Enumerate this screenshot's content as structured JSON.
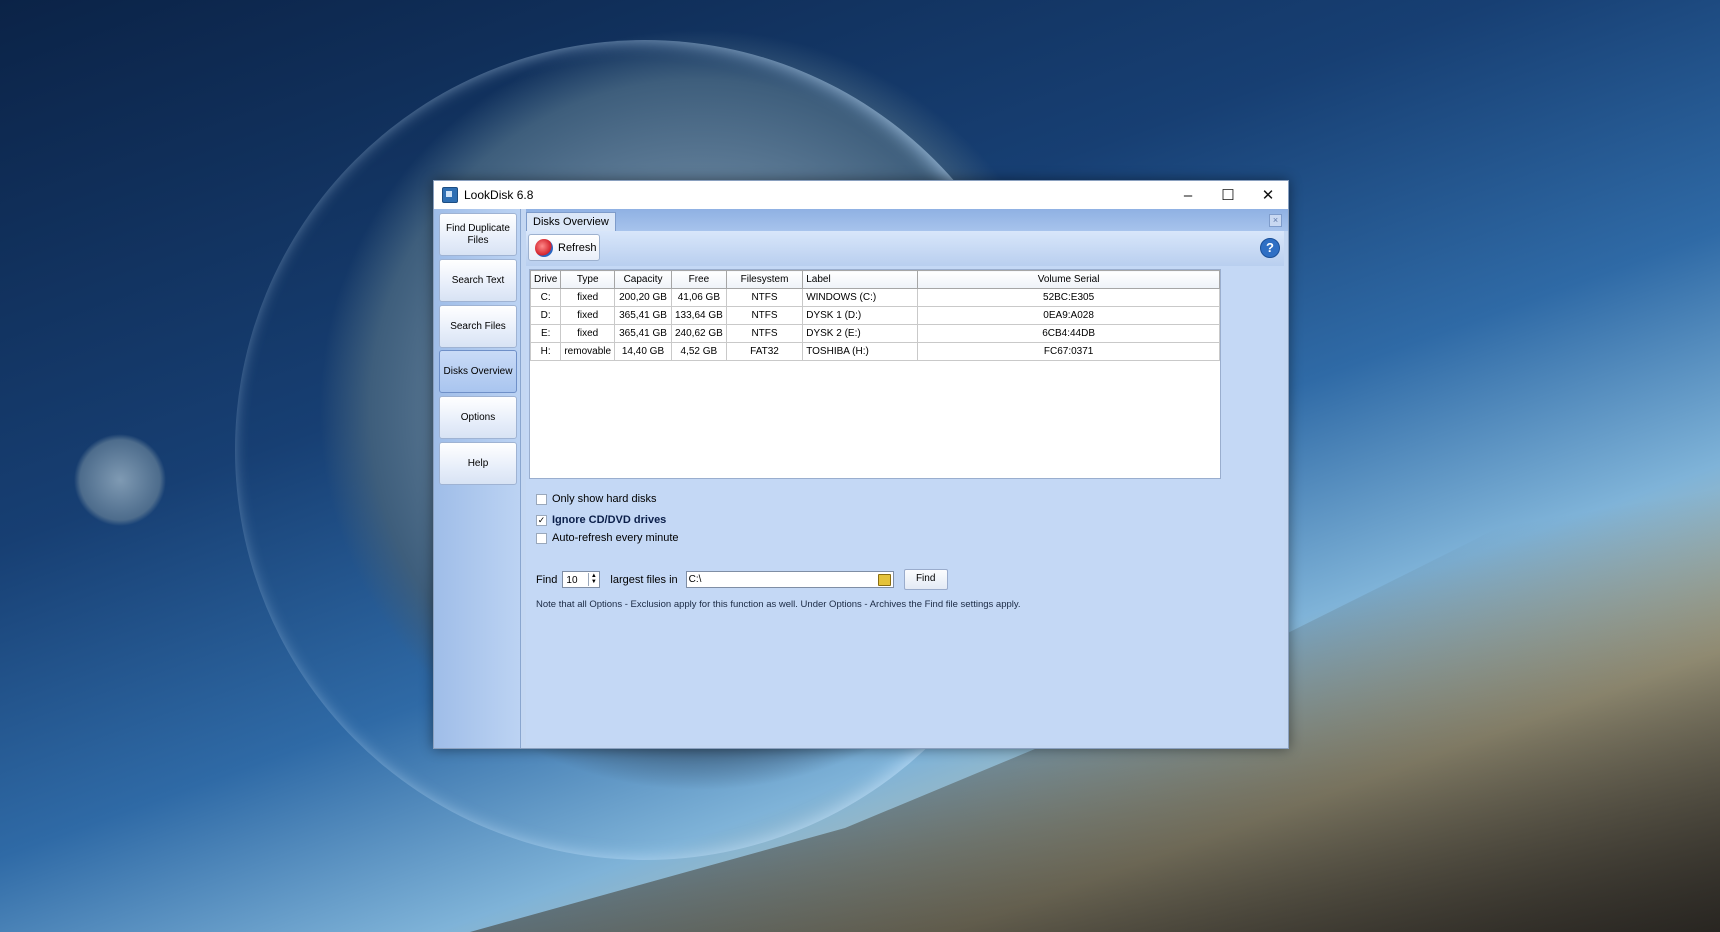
{
  "window": {
    "title": "LookDisk 6.8",
    "icons": {
      "app": "app-icon",
      "minimize": "minimize-icon",
      "maximize": "maximize-icon",
      "close": "close-icon"
    }
  },
  "sidebar": {
    "items": [
      {
        "label": "Find Duplicate Files",
        "active": false
      },
      {
        "label": "Search Text",
        "active": false
      },
      {
        "label": "Search Files",
        "active": false
      },
      {
        "label": "Disks Overview",
        "active": true
      },
      {
        "label": "Options",
        "active": false
      },
      {
        "label": "Help",
        "active": false
      }
    ]
  },
  "tab": {
    "label": "Disks Overview"
  },
  "toolbar": {
    "refresh_label": "Refresh",
    "help_glyph": "?"
  },
  "table": {
    "columns": [
      "Drive",
      "Type",
      "Capacity",
      "Free",
      "Filesystem",
      "Label",
      "Volume Serial"
    ],
    "rows": [
      [
        "C:",
        "fixed",
        "200,20 GB",
        "41,06 GB",
        "NTFS",
        "WINDOWS (C:)",
        "52BC:E305"
      ],
      [
        "D:",
        "fixed",
        "365,41 GB",
        "133,64 GB",
        "NTFS",
        "DYSK 1 (D:)",
        "0EA9:A028"
      ],
      [
        "E:",
        "fixed",
        "365,41 GB",
        "240,62 GB",
        "NTFS",
        "DYSK 2 (E:)",
        "6CB4:44DB"
      ],
      [
        "H:",
        "removable",
        "14,40 GB",
        "4,52 GB",
        "FAT32",
        "TOSHIBA (H:)",
        "FC67:0371"
      ]
    ]
  },
  "options": {
    "only_hard_disks": {
      "label": "Only show hard disks",
      "checked": false
    },
    "ignore_cd": {
      "label": "Ignore CD/DVD drives",
      "checked": true
    },
    "auto_refresh": {
      "label": "Auto-refresh every minute",
      "checked": false
    }
  },
  "find": {
    "find_label": "Find",
    "count_value": "10",
    "largest_label": "largest files in",
    "path_value": "C:\\",
    "button_label": "Find"
  },
  "note": "Note that all Options - Exclusion apply for this function as well. Under Options  - Archives the Find file settings apply."
}
